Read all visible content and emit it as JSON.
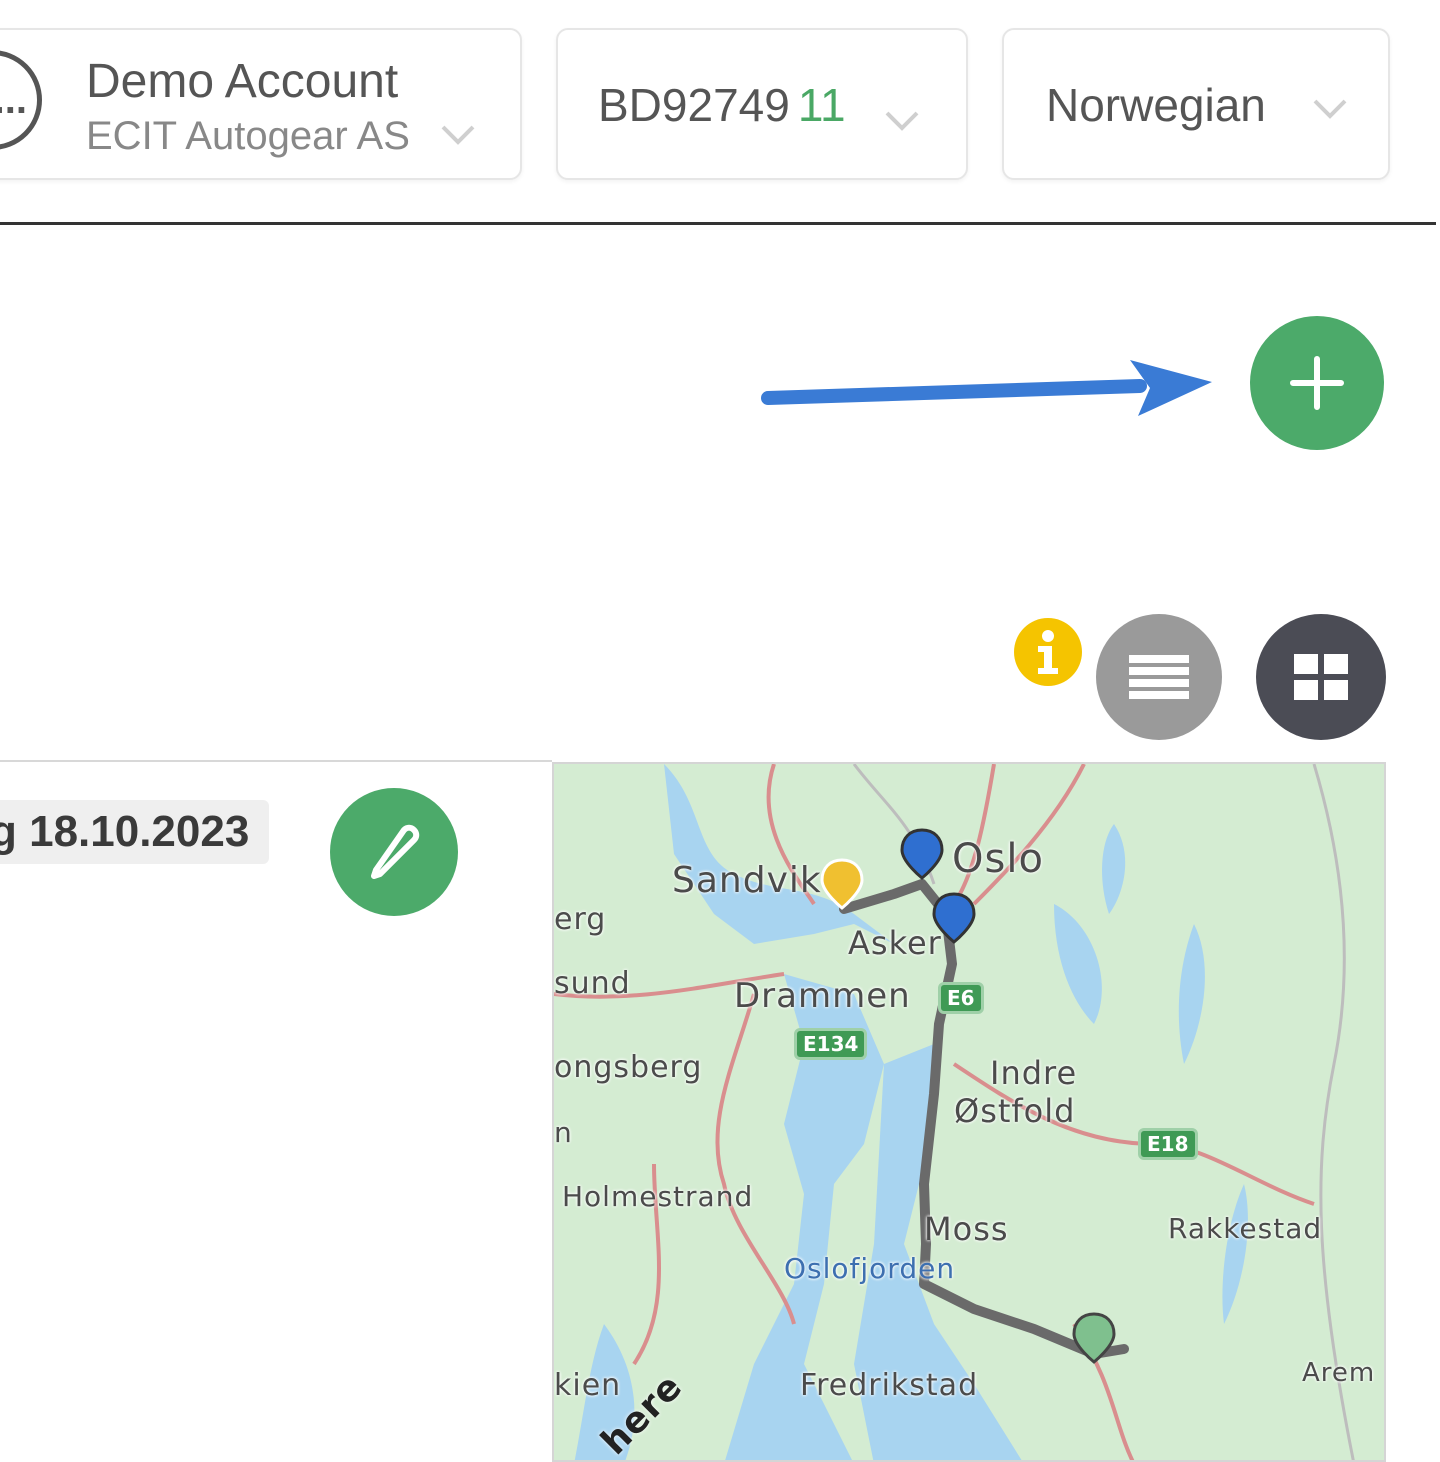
{
  "header": {
    "account": {
      "avatar_text": "J...",
      "name": "Demo Account",
      "organization": "ECIT Autogear AS"
    },
    "vehicle": {
      "plate": "BD92749",
      "count": "11"
    },
    "language": {
      "selected": "Norwegian"
    }
  },
  "trip": {
    "date_label": "g 18.10.2023"
  },
  "map": {
    "places": {
      "sandvika": "Sandvik",
      "oslo": "Oslo",
      "asker": "Asker",
      "drammen": "Drammen",
      "erg": "erg",
      "sund": "sund",
      "kongsberg": "ongsberg",
      "indre": "Indre",
      "ostfold": "Østfold",
      "holmestrand": "Holmestrand",
      "moss": "Moss",
      "rakkestad": "Rakkestad",
      "oslofjorden": "Oslofjorden",
      "skien": "kien",
      "fredrikstad": "Fredrikstad",
      "arem": "Arem",
      "n": "n"
    },
    "shields": {
      "e6": "E6",
      "e134": "E134",
      "e18": "E18"
    },
    "provider_logo": "here"
  },
  "colors": {
    "accent_green": "#4caa6a",
    "info_yellow": "#f5c400",
    "arrow_blue": "#3a7bd5",
    "map_land": "#d4ecd2",
    "map_water": "#a8d4f0",
    "route": "#666666"
  },
  "icons": {
    "add": "plus-icon",
    "info": "info-icon",
    "list_view": "list-icon",
    "grid_view": "grid-icon",
    "edit": "pencil-icon",
    "dropdown": "chevron-down-icon"
  }
}
